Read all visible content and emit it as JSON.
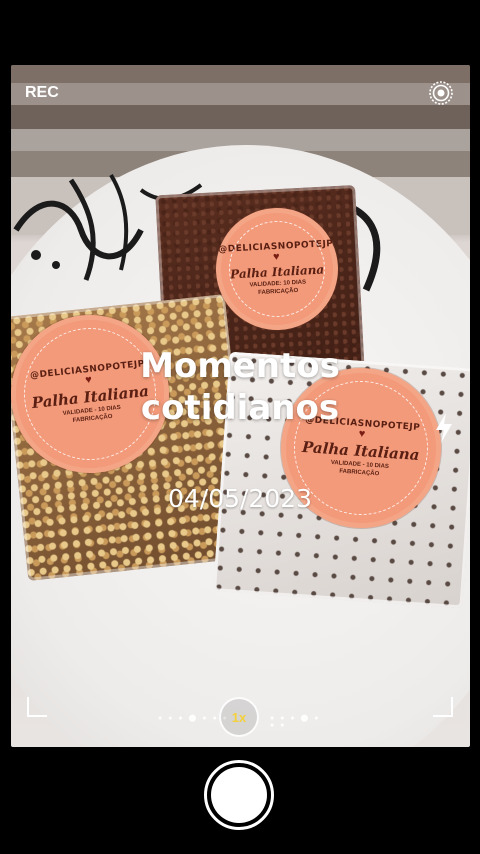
{
  "camera": {
    "rec_label": "REC",
    "zoom_label": "1x",
    "zoom_color": "#f4d13b"
  },
  "overlay": {
    "title_line1": "Momentos",
    "title_line2": "cotidianos",
    "date": "04/05/2023"
  },
  "stickers": [
    {
      "handle": "@DELICIASNOPOTEJP",
      "name": "Palha Italiana",
      "small_line1": "VALIDADE: 10 DIAS",
      "small_line2": "FABRICAÇÃO"
    },
    {
      "handle": "@DELICIASNOPOTEJP",
      "name": "Palha Italiana",
      "small_line1": "VALIDADE - 10 DIAS",
      "small_line2": "FABRICAÇÃO"
    },
    {
      "handle": "@DELICIASNOPOTEJP",
      "name": "Palha Italiana",
      "small_line1": "VALIDADE - 10 DIAS",
      "small_line2": "FABRICAÇÃO"
    }
  ],
  "icons": {
    "live": "live-photo-icon",
    "flash": "flash-icon"
  },
  "colors": {
    "sticker": "#f29a7a",
    "background": "#000000"
  }
}
